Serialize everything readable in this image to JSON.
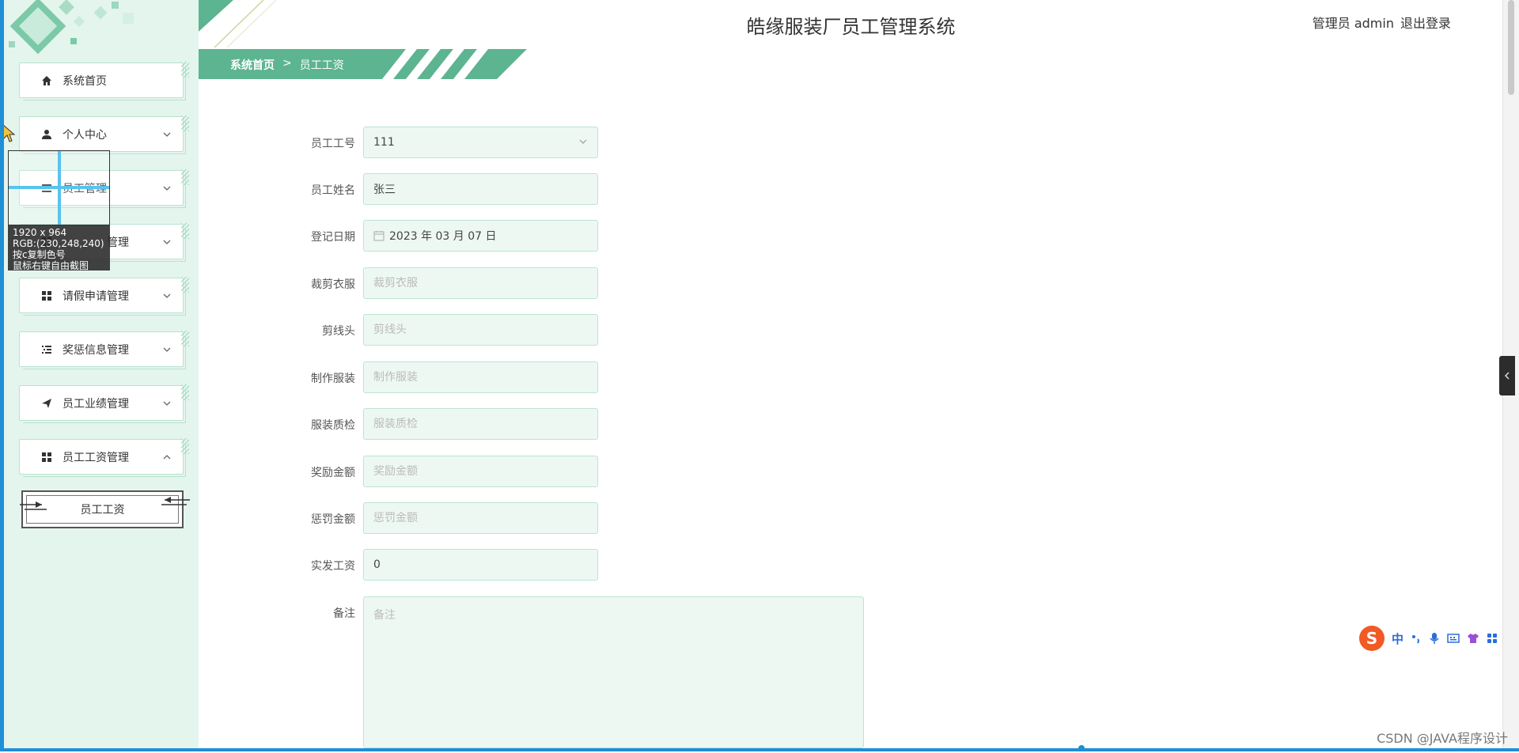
{
  "app": {
    "title": "皓缘服装厂员工管理系统",
    "role_label": "管理员 admin",
    "logout_label": "退出登录"
  },
  "breadcrumb": {
    "home": "系统首页",
    "separator": ">",
    "current": "员工工资"
  },
  "sidebar": {
    "items": [
      {
        "label": "系统首页",
        "icon": "home-icon"
      },
      {
        "label": "个人中心",
        "icon": "user-icon"
      },
      {
        "label": "员工管理",
        "icon": "list-icon"
      },
      {
        "label": "管理",
        "icon": "grid-icon"
      },
      {
        "label": "请假申请管理",
        "icon": "grid-icon"
      },
      {
        "label": "奖惩信息管理",
        "icon": "list-indent-icon"
      },
      {
        "label": "员工业绩管理",
        "icon": "send-icon"
      },
      {
        "label": "员工工资管理",
        "icon": "grid-icon"
      }
    ],
    "submenu": {
      "label": "员工工资"
    }
  },
  "capture_tool": {
    "size": "1920 x 964",
    "rgb": "RGB:(230,248,240)",
    "hint1": "按c复制色号",
    "hint2": "鼠标右键自由截图"
  },
  "form": {
    "employee_no": {
      "label": "员工工号",
      "value": "111"
    },
    "employee_name": {
      "label": "员工姓名",
      "value": "张三"
    },
    "register_date": {
      "label": "登记日期",
      "value": "2023 年 03 月 07 日"
    },
    "cut_clothes": {
      "label": "裁剪衣服",
      "placeholder": "裁剪衣服"
    },
    "cut_thread": {
      "label": "剪线头",
      "placeholder": "剪线头"
    },
    "make_clothes": {
      "label": "制作服装",
      "placeholder": "制作服装"
    },
    "quality_check": {
      "label": "服装质检",
      "placeholder": "服装质检"
    },
    "bonus": {
      "label": "奖励金额",
      "placeholder": "奖励金额"
    },
    "penalty": {
      "label": "惩罚金额",
      "placeholder": "惩罚金额"
    },
    "net_salary": {
      "label": "实发工资",
      "value": "0"
    },
    "remark": {
      "label": "备注",
      "placeholder": "备注"
    }
  },
  "ime": {
    "logo": "S",
    "mode": "中"
  },
  "watermark": "CSDN @JAVA程序设计",
  "colors": {
    "sidebar_bg": "#e4f5ee",
    "accent_green": "#5db491",
    "field_bg": "#eef8f3",
    "field_border": "#bde4d3"
  }
}
